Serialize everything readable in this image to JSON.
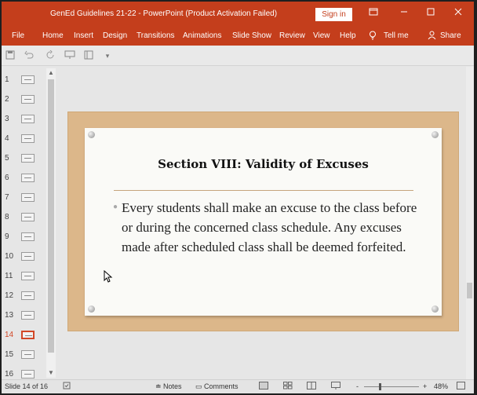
{
  "titlebar": {
    "title": "GenEd Guidelines 21-22  -  PowerPoint (Product Activation Failed)",
    "signin_label": "Sign in"
  },
  "ribbon": {
    "tabs": [
      "File",
      "Home",
      "Insert",
      "Design",
      "Transitions",
      "Animations",
      "Slide Show",
      "Review",
      "View",
      "Help"
    ],
    "tell_me": "Tell me",
    "share": "Share"
  },
  "thumbnails": {
    "numbers": [
      "1",
      "2",
      "3",
      "4",
      "5",
      "6",
      "7",
      "8",
      "9",
      "10",
      "11",
      "12",
      "13",
      "14",
      "15",
      "16"
    ],
    "active": "14"
  },
  "slide": {
    "title": "Section VIII: Validity of Excuses",
    "bullet": "Every students shall make an excuse to the class before or during the concerned class schedule. Any excuses made after scheduled class shall be deemed forfeited."
  },
  "status": {
    "slide_info": "Slide 14 of 16",
    "notes": "Notes",
    "comments": "Comments",
    "zoom_minus": "-",
    "zoom_plus": "+",
    "zoom": "48%"
  },
  "colors": {
    "accent": "#c43e1c",
    "active_thumb": "#d24726"
  },
  "icons": [
    "save-icon",
    "undo-icon",
    "redo-icon",
    "present-icon",
    "layout-icon",
    "customize-icon",
    "lightbulb-icon",
    "person-icon",
    "restore-icon",
    "minimize-icon",
    "maximize-icon",
    "close-icon"
  ]
}
